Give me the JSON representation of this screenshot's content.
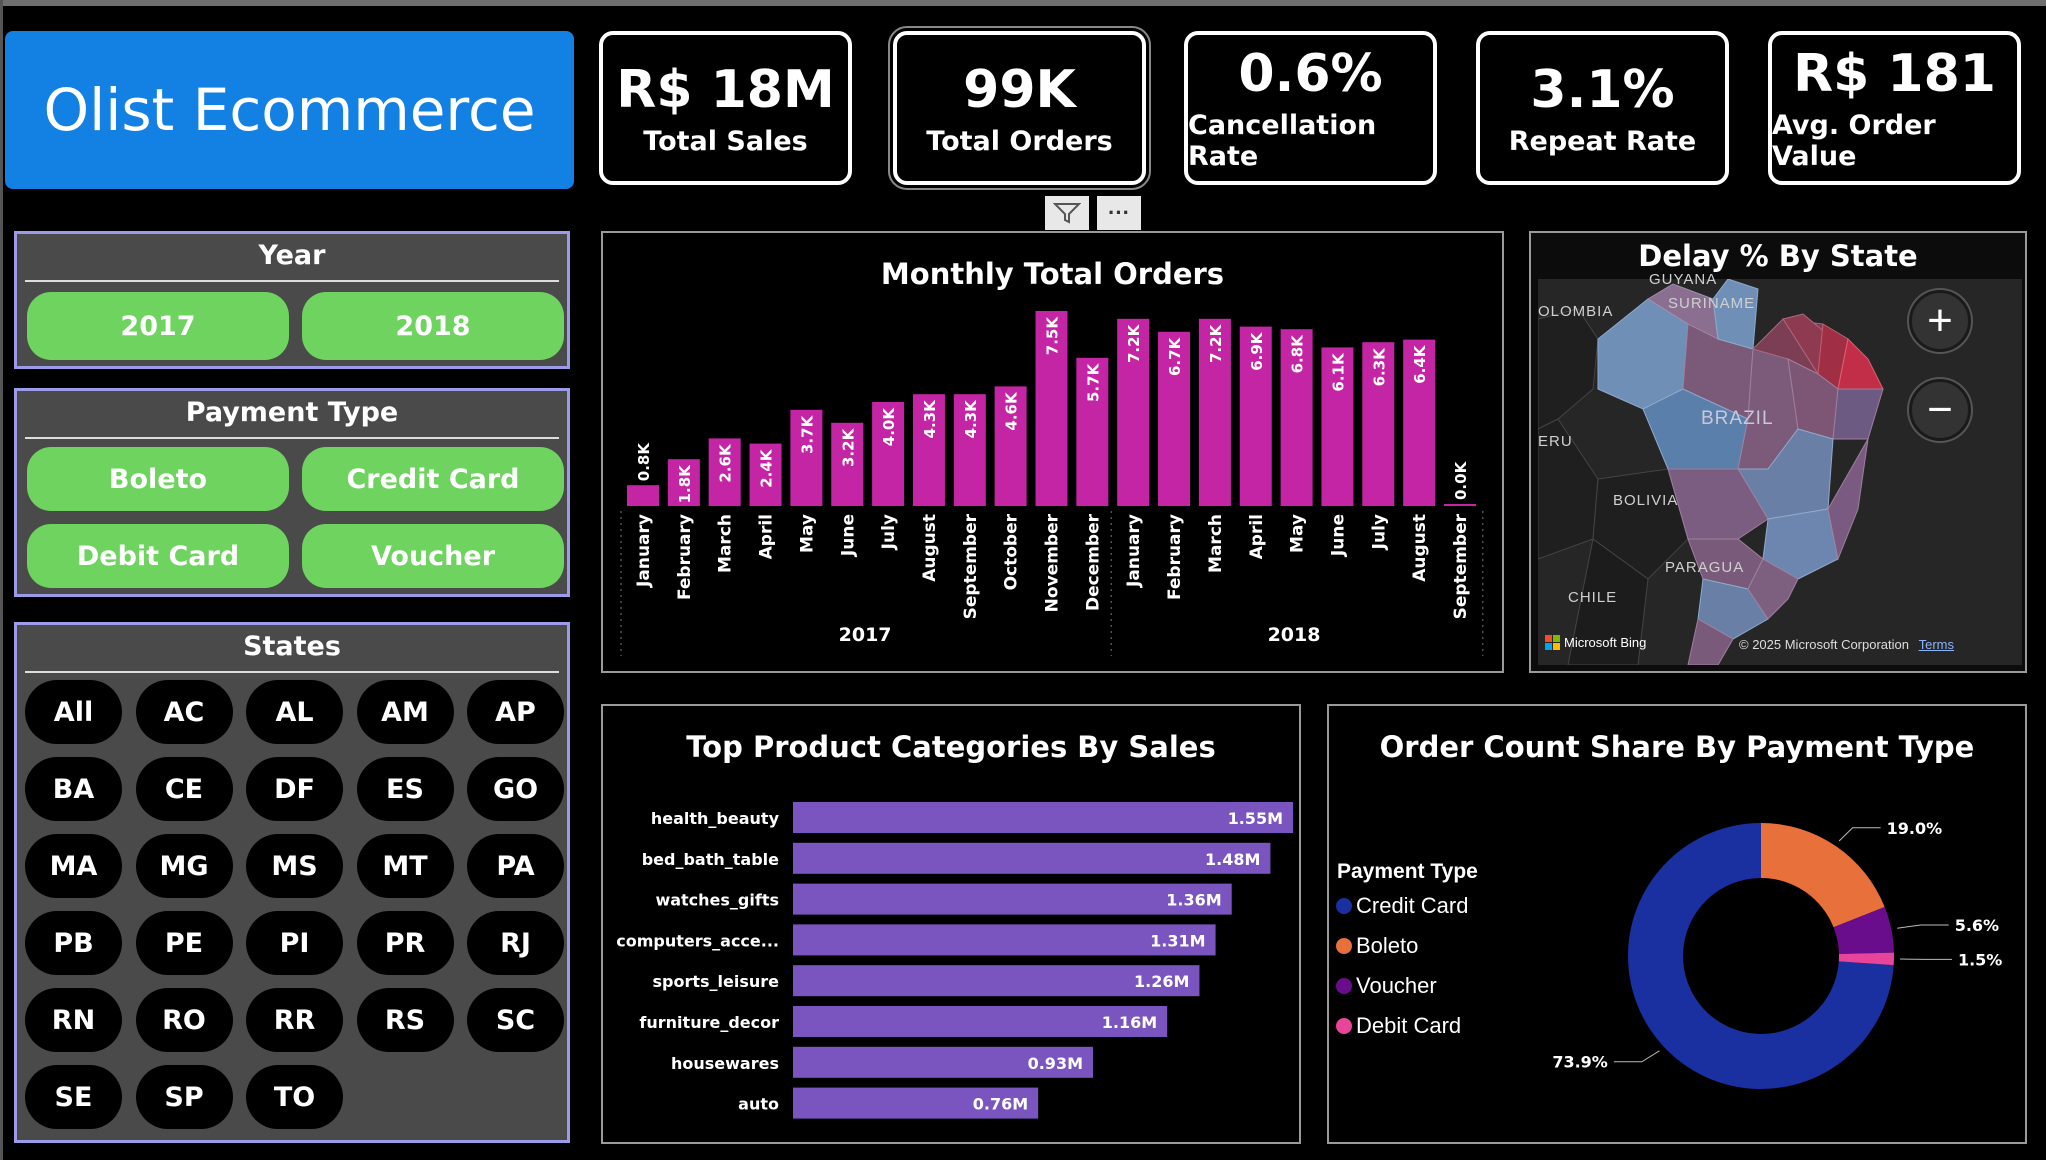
{
  "title": "Olist Ecommerce",
  "kpis": [
    {
      "value": "R$ 18M",
      "label": "Total Sales"
    },
    {
      "value": "99K",
      "label": "Total Orders"
    },
    {
      "value": "0.6%",
      "label": "Cancellation Rate"
    },
    {
      "value": "3.1%",
      "label": "Repeat Rate"
    },
    {
      "value": "R$ 181",
      "label": "Avg. Order Value"
    }
  ],
  "toolbar": {
    "filter_icon": "filter-icon",
    "more_label": "···"
  },
  "slicers": {
    "year": {
      "title": "Year",
      "options": [
        "2017",
        "2018"
      ]
    },
    "payment": {
      "title": "Payment Type",
      "options": [
        "Boleto",
        "Credit Card",
        "Debit Card",
        "Voucher"
      ]
    },
    "states": {
      "title": "States",
      "options": [
        "All",
        "AC",
        "AL",
        "AM",
        "AP",
        "BA",
        "CE",
        "DF",
        "ES",
        "GO",
        "MA",
        "MG",
        "MS",
        "MT",
        "PA",
        "PB",
        "PE",
        "PI",
        "PR",
        "RJ",
        "RN",
        "RO",
        "RR",
        "RS",
        "SC",
        "SE",
        "SP",
        "TO"
      ]
    }
  },
  "colors": {
    "title_bg": "#1380e3",
    "pill_green": "#6ed35f",
    "bar_magenta": "#c425a4",
    "bar_purple": "#7a55bf",
    "credit_card": "#1a2fa0",
    "boleto": "#e8703a",
    "voucher": "#6a0d8c",
    "debit_card": "#e8459a"
  },
  "monthly": {
    "title": "Monthly Total Orders",
    "years": [
      "2017",
      "2018"
    ],
    "chart_data": {
      "type": "bar",
      "categories": [
        "January",
        "February",
        "March",
        "April",
        "May",
        "June",
        "July",
        "August",
        "September",
        "October",
        "November",
        "December",
        "January",
        "February",
        "March",
        "April",
        "May",
        "June",
        "July",
        "August",
        "September"
      ],
      "groups": [
        {
          "name": "2017",
          "count": 12
        },
        {
          "name": "2018",
          "count": 9
        }
      ],
      "values": [
        800,
        1800,
        2600,
        2400,
        3700,
        3200,
        4000,
        4300,
        4300,
        4600,
        7500,
        5700,
        7200,
        6700,
        7200,
        6900,
        6800,
        6100,
        6300,
        6400,
        0
      ],
      "labels": [
        "0.8K",
        "1.8K",
        "2.6K",
        "2.4K",
        "3.7K",
        "3.2K",
        "4.0K",
        "4.3K",
        "4.3K",
        "4.6K",
        "7.5K",
        "5.7K",
        "7.2K",
        "6.7K",
        "7.2K",
        "6.9K",
        "6.8K",
        "6.1K",
        "6.3K",
        "6.4K",
        "0.0K"
      ],
      "ylim": [
        0,
        7500
      ]
    }
  },
  "map": {
    "title": "Delay % By State",
    "labels": {
      "guyana": "GUYANA",
      "suriname": "SURINAME",
      "colombia": "OLOMBIA",
      "peru": "ERU",
      "brazil": "BRAZIL",
      "bolivia": "BOLIVIA",
      "paraguay": "PARAGUA",
      "chile": "CHILE"
    },
    "zoom_in": "+",
    "zoom_out": "−",
    "attribution": "Microsoft Bing",
    "copyright": "© 2025 Microsoft Corporation",
    "terms": "Terms"
  },
  "categories_chart": {
    "title": "Top Product Categories By Sales",
    "chart_data": {
      "type": "bar",
      "orientation": "horizontal",
      "categories": [
        "health_beauty",
        "bed_bath_table",
        "watches_gifts",
        "computers_acce...",
        "sports_leisure",
        "furniture_decor",
        "housewares",
        "auto"
      ],
      "values": [
        1.55,
        1.48,
        1.36,
        1.31,
        1.26,
        1.16,
        0.93,
        0.76
      ],
      "labels": [
        "1.55M",
        "1.48M",
        "1.36M",
        "1.31M",
        "1.26M",
        "1.16M",
        "0.93M",
        "0.76M"
      ],
      "unit": "M",
      "xlim": [
        0,
        1.55
      ]
    }
  },
  "payment_chart": {
    "title": "Order Count Share By Payment Type",
    "legend_title": "Payment Type",
    "chart_data": {
      "type": "pie",
      "donut": true,
      "categories": [
        "Credit Card",
        "Boleto",
        "Voucher",
        "Debit Card"
      ],
      "values": [
        73.9,
        19.0,
        5.6,
        1.5
      ],
      "labels": [
        "73.9%",
        "19.0%",
        "5.6%",
        "1.5%"
      ],
      "colors": [
        "#1a2fa0",
        "#e8703a",
        "#6a0d8c",
        "#e8459a"
      ]
    }
  }
}
